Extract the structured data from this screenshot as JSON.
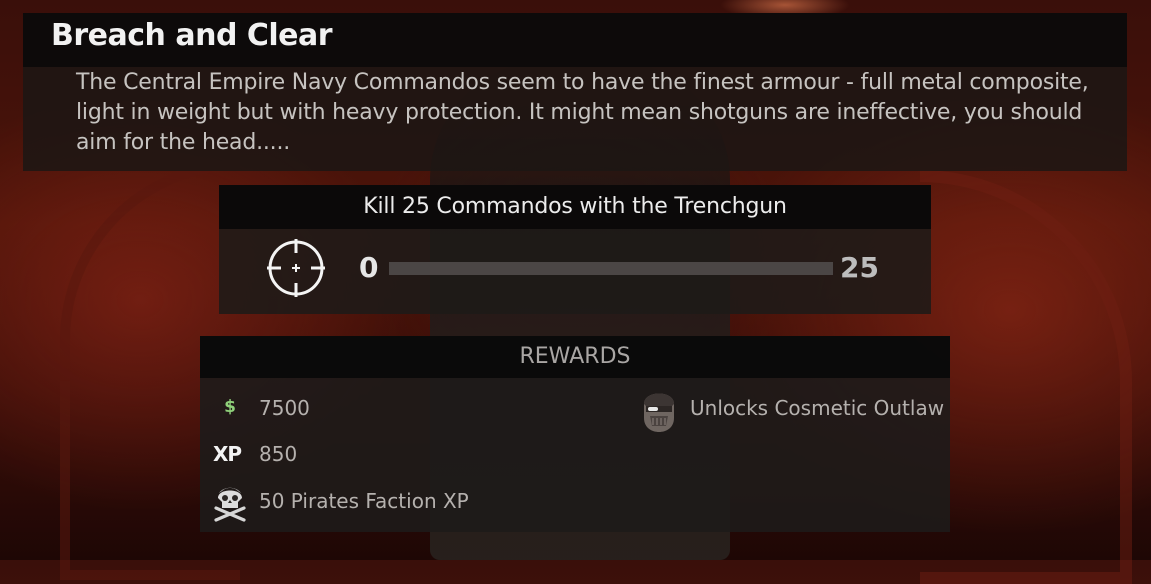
{
  "mission": {
    "title": "Breach and Clear",
    "description": "The Central Empire Navy Commandos seem to have the finest armour - full metal composite, light in weight but with heavy protection. It might mean shotguns are ineffective, you should aim for the head....."
  },
  "objective": {
    "text": "Kill 25 Commandos with the Trenchgun",
    "icon": "crosshair-icon",
    "progress_current": "0",
    "progress_target": "25",
    "progress_fraction": 0
  },
  "rewards": {
    "title": "REWARDS",
    "money": {
      "icon": "dollar-icon",
      "symbol": "$",
      "value": "7500",
      "color": "#8fd07a"
    },
    "xp": {
      "icon": "xp-icon",
      "symbol": "XP",
      "value": "850"
    },
    "faction": {
      "icon": "pirate-skull-icon",
      "text": "50 Pirates Faction XP"
    },
    "cosmetic": {
      "icon": "outlaw-mask-icon",
      "text": "Unlocks Cosmetic Outlaw"
    }
  }
}
